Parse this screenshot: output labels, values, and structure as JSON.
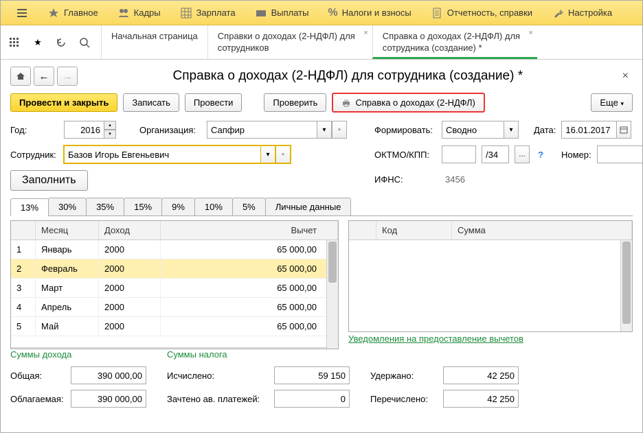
{
  "top_menu": [
    "Главное",
    "Кадры",
    "Зарплата",
    "Выплаты",
    "Налоги и взносы",
    "Отчетность, справки",
    "Настройка"
  ],
  "tabs": [
    {
      "label": "Начальная страница",
      "closable": false
    },
    {
      "label": "Справки о доходах (2-НДФЛ) для сотрудников",
      "closable": true
    },
    {
      "label": "Справка о доходах (2-НДФЛ) для сотрудника (создание) *",
      "closable": true,
      "active": true
    }
  ],
  "page_title": "Справка о доходах (2-НДФЛ) для сотрудника (создание) *",
  "buttons": {
    "primary": "Провести и закрыть",
    "save": "Записать",
    "post": "Провести",
    "check": "Проверить",
    "cert": "Справка о доходах (2-НДФЛ)",
    "more": "Еще",
    "fill": "Заполнить"
  },
  "fields": {
    "year_label": "Год:",
    "year": "2016",
    "org_label": "Организация:",
    "org": "Сапфир",
    "form_label": "Формировать:",
    "form": "Сводно",
    "date_label": "Дата:",
    "date": "16.01.2017",
    "emp_label": "Сотрудник:",
    "emp": "Базов Игорь Евгеньевич",
    "oktmo_label": "ОКТМО/КПП:",
    "oktmo1": "",
    "oktmo2": "/34",
    "num_label": "Номер:",
    "num": "",
    "ifns_label": "ИФНС:",
    "ifns": "3456"
  },
  "rate_tabs": [
    "13%",
    "30%",
    "35%",
    "15%",
    "9%",
    "10%",
    "5%",
    "Личные данные"
  ],
  "left_table": {
    "headers": {
      "month": "Месяц",
      "income": "Доход",
      "deduction": "Вычет"
    },
    "rows": [
      {
        "n": "1",
        "month": "Январь",
        "income": "2000",
        "ded": "65 000,00"
      },
      {
        "n": "2",
        "month": "Февраль",
        "income": "2000",
        "ded": "65 000,00",
        "sel": true
      },
      {
        "n": "3",
        "month": "Март",
        "income": "2000",
        "ded": "65 000,00"
      },
      {
        "n": "4",
        "month": "Апрель",
        "income": "2000",
        "ded": "65 000,00"
      },
      {
        "n": "5",
        "month": "Май",
        "income": "2000",
        "ded": "65 000,00"
      }
    ]
  },
  "right_table": {
    "headers": {
      "code": "Код",
      "sum": "Сумма"
    }
  },
  "link": "Уведомления на предоставление вычетов",
  "totals": {
    "income_head": "Суммы дохода",
    "tax_head": "Суммы налога",
    "total_label": "Общая:",
    "total": "390 000,00",
    "taxable_label": "Облагаемая:",
    "taxable": "390 000,00",
    "calc_label": "Исчислено:",
    "calc": "59 150",
    "adv_label": "Зачтено ав. платежей:",
    "adv": "0",
    "withheld_label": "Удержано:",
    "withheld": "42 250",
    "transferred_label": "Перечислено:",
    "transferred": "42 250"
  }
}
